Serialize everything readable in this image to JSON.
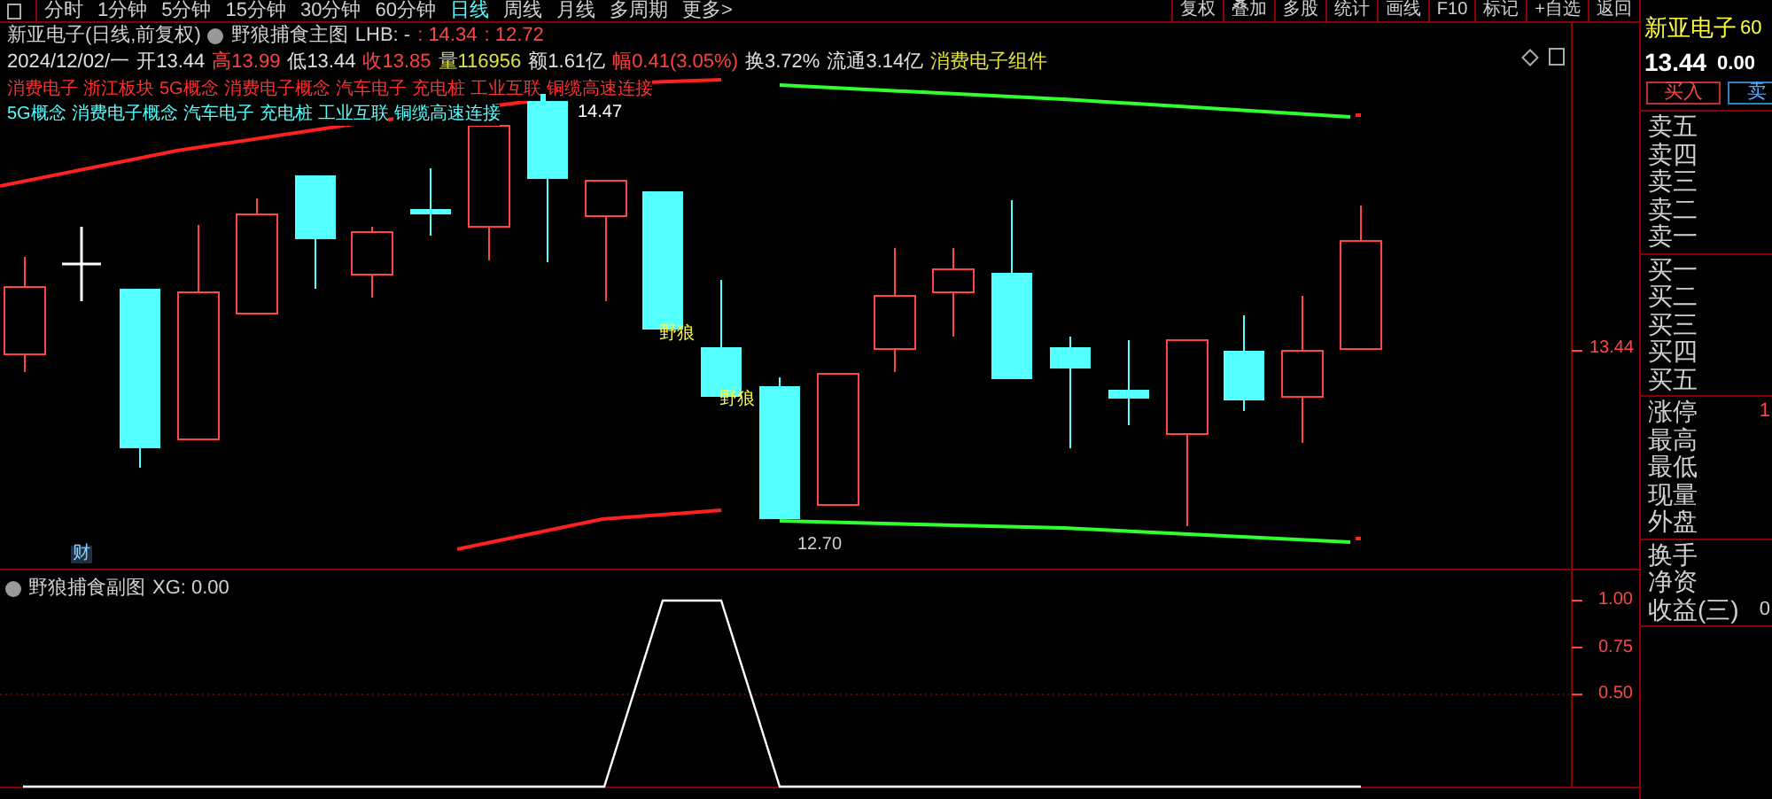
{
  "toolbar": {
    "periods": [
      {
        "label": "分时",
        "selected": false
      },
      {
        "label": "1分钟",
        "selected": false
      },
      {
        "label": "5分钟",
        "selected": false
      },
      {
        "label": "15分钟",
        "selected": false
      },
      {
        "label": "30分钟",
        "selected": false
      },
      {
        "label": "60分钟",
        "selected": false
      },
      {
        "label": "日线",
        "selected": true
      },
      {
        "label": "周线",
        "selected": false
      },
      {
        "label": "月线",
        "selected": false
      },
      {
        "label": "多周期",
        "selected": false
      },
      {
        "label": "更多>",
        "selected": false
      }
    ],
    "actions": [
      "复权",
      "叠加",
      "多股",
      "统计",
      "画线",
      "F10",
      "标记",
      "+自选",
      "返回"
    ]
  },
  "main_chart": {
    "title": "新亚电子(日线,前复权)",
    "indicator": "野狼捕食主图",
    "lhb": "LHB: -",
    "values": [
      ": 14.34",
      ": 12.72"
    ],
    "quote": [
      {
        "text": "2024/12/02/一",
        "color": "#e0e0e0"
      },
      {
        "text": "开13.44",
        "color": "#e0e0e0"
      },
      {
        "text": "高13.99",
        "color": "#ff4040"
      },
      {
        "text": "低13.44",
        "color": "#e0e0e0"
      },
      {
        "text": "收13.85",
        "color": "#ff4040"
      },
      {
        "text": "量116956",
        "color": "#e0e040"
      },
      {
        "text": "额1.61亿",
        "color": "#e0e0e0"
      },
      {
        "text": "幅0.41(3.05%)",
        "color": "#ff4040"
      },
      {
        "text": "换3.72%",
        "color": "#e0e0e0"
      },
      {
        "text": "流通3.14亿",
        "color": "#e0e0e0"
      },
      {
        "text": "消费电子组件",
        "color": "#e0e040"
      }
    ],
    "tags_red": [
      "消费电子",
      "浙江板块",
      "5G概念",
      "消费电子概念",
      "汽车电子",
      "充电桩",
      "工业互联",
      "铜缆高速连接"
    ],
    "tags_cyan": [
      "5G概念",
      "消费电子概念",
      "汽车电子",
      "充电桩",
      "工业互联",
      "铜缆高速连接"
    ],
    "signals": [
      "野狼",
      "野狼"
    ],
    "high_label": "14.47",
    "low_label": "12.70",
    "finance_badge": "财",
    "price_tick": "13.44"
  },
  "sub_chart": {
    "title": "野狼捕食副图",
    "reading": "XG: 0.00",
    "axis_ticks": [
      "1.00",
      "0.75",
      "0.50"
    ]
  },
  "quote_panel": {
    "name": "新亚电子",
    "code": "60",
    "price": "13.44",
    "change": "0.00",
    "buy": "买入",
    "sell": "卖",
    "sell_levels": [
      "卖五",
      "卖四",
      "卖三",
      "卖二",
      "卖一"
    ],
    "buy_levels": [
      "买一",
      "买二",
      "买三",
      "买四",
      "买五"
    ],
    "stats": [
      {
        "label": "涨停",
        "value": "1"
      },
      {
        "label": "最高"
      },
      {
        "label": "最低"
      },
      {
        "label": "现量"
      },
      {
        "label": "外盘"
      }
    ],
    "fundamentals": [
      {
        "label": "换手"
      },
      {
        "label": "净资"
      },
      {
        "label": "收益(三)",
        "value": "0"
      }
    ]
  }
}
